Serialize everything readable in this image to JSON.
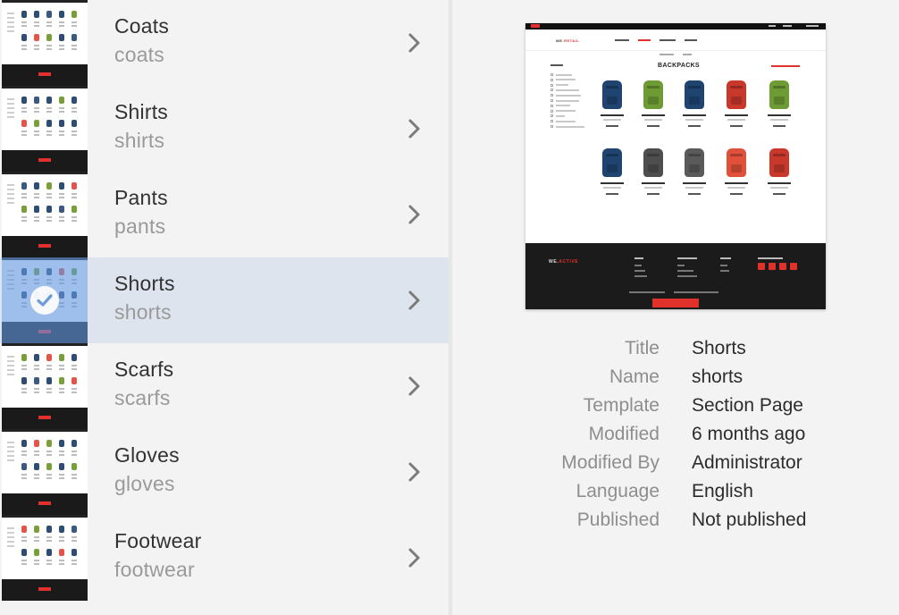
{
  "items": [
    {
      "title": "Coats",
      "name": "coats",
      "selected": false
    },
    {
      "title": "Shirts",
      "name": "shirts",
      "selected": false
    },
    {
      "title": "Pants",
      "name": "pants",
      "selected": false
    },
    {
      "title": "Shorts",
      "name": "shorts",
      "selected": true
    },
    {
      "title": "Scarfs",
      "name": "scarfs",
      "selected": false
    },
    {
      "title": "Gloves",
      "name": "gloves",
      "selected": false
    },
    {
      "title": "Footwear",
      "name": "footwear",
      "selected": false
    }
  ],
  "icons": {
    "chevron": "chevron-right-icon",
    "check": "checkmark-icon"
  },
  "preview": {
    "page_heading": "BACKPACKS",
    "logo_main": "WE.",
    "logo_accent": "RETAIL",
    "footer_logo_main": "WE.",
    "footer_logo_accent": "ACTIVE"
  },
  "metadata": [
    {
      "label": "Title",
      "value": "Shorts"
    },
    {
      "label": "Name",
      "value": "shorts"
    },
    {
      "label": "Template",
      "value": "Section Page"
    },
    {
      "label": "Modified",
      "value": "6 months ago"
    },
    {
      "label": "Modified By",
      "value": "Administrator"
    },
    {
      "label": "Language",
      "value": "English"
    },
    {
      "label": "Published",
      "value": "Not published"
    }
  ],
  "colors": {
    "selected_row": "#dee4ed",
    "selection_overlay": "#6396de",
    "accent_red": "#e0312b",
    "title_text": "#323232",
    "subtitle_text": "#9a9a9a"
  }
}
